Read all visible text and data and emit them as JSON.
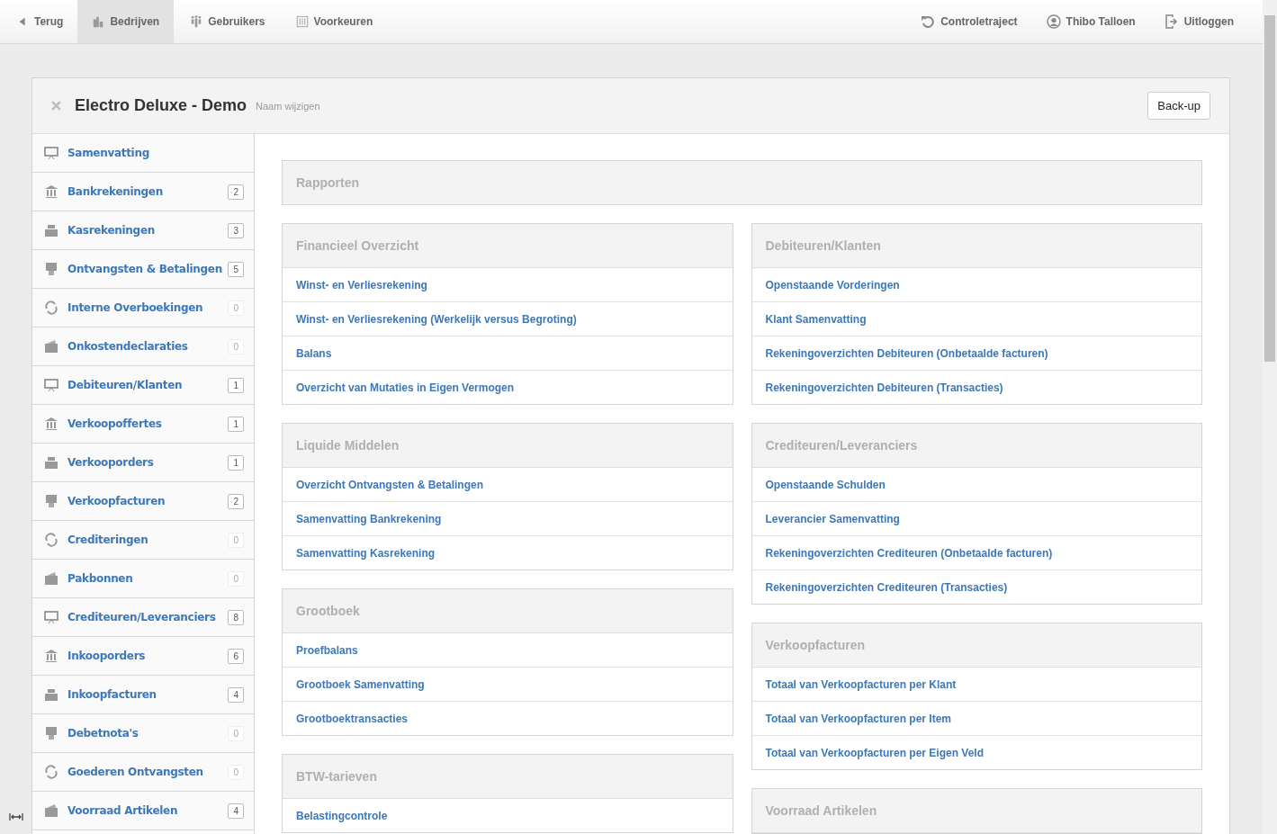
{
  "nav": {
    "left": [
      {
        "label": "Terug",
        "selected": false
      },
      {
        "label": "Bedrijven",
        "selected": true
      },
      {
        "label": "Gebruikers",
        "selected": false
      },
      {
        "label": "Voorkeuren",
        "selected": false
      }
    ],
    "right": [
      {
        "label": "Controletraject"
      },
      {
        "label": "Thibo Talloen"
      },
      {
        "label": "Uitloggen"
      }
    ]
  },
  "company": {
    "name": "Electro Deluxe - Demo",
    "rename_link": "Naam wijzigen",
    "backup_button": "Back-up"
  },
  "sidebar": {
    "items": [
      {
        "label": "Samenvatting"
      },
      {
        "label": "Bankrekeningen",
        "count": "2",
        "disabled": false
      },
      {
        "label": "Kasrekeningen",
        "count": "3",
        "disabled": false
      },
      {
        "label": "Ontvangsten & Betalingen",
        "count": "5",
        "disabled": false
      },
      {
        "label": "Interne Overboekingen",
        "count": "0",
        "disabled": true
      },
      {
        "label": "Onkostendeclaraties",
        "count": "0",
        "disabled": true
      },
      {
        "label": "Debiteuren/Klanten",
        "count": "1",
        "disabled": false
      },
      {
        "label": "Verkoopoffertes",
        "count": "1",
        "disabled": false
      },
      {
        "label": "Verkooporders",
        "count": "1",
        "disabled": false
      },
      {
        "label": "Verkoopfacturen",
        "count": "2",
        "disabled": false
      },
      {
        "label": "Crediteringen",
        "count": "0",
        "disabled": true
      },
      {
        "label": "Pakbonnen",
        "count": "0",
        "disabled": true
      },
      {
        "label": "Crediteuren/Leveranciers",
        "count": "8",
        "disabled": false
      },
      {
        "label": "Inkooporders",
        "count": "6",
        "disabled": false
      },
      {
        "label": "Inkoopfacturen",
        "count": "4",
        "disabled": false
      },
      {
        "label": "Debetnota's",
        "count": "0",
        "disabled": true
      },
      {
        "label": "Goederen Ontvangsten",
        "count": "0",
        "disabled": true
      },
      {
        "label": "Voorraad Artikelen",
        "count": "4",
        "disabled": false
      }
    ]
  },
  "reports": {
    "title": "Rapporten",
    "columns": [
      [
        {
          "title": "Financieel Overzicht",
          "links": [
            "Winst- en Verliesrekening",
            "Winst- en Verliesrekening (Werkelijk versus Begroting)",
            "Balans",
            "Overzicht van Mutaties in Eigen Vermogen"
          ]
        },
        {
          "title": "Liquide Middelen",
          "links": [
            "Overzicht Ontvangsten & Betalingen",
            "Samenvatting Bankrekening",
            "Samenvatting Kasrekening"
          ]
        },
        {
          "title": "Grootboek",
          "links": [
            "Proefbalans",
            "Grootboek Samenvatting",
            "Grootboektransacties"
          ]
        },
        {
          "title": "BTW-tarieven",
          "links": [
            "Belastingcontrole"
          ]
        }
      ],
      [
        {
          "title": "Debiteuren/Klanten",
          "links": [
            "Openstaande Vorderingen",
            "Klant Samenvatting",
            "Rekeningoverzichten Debiteuren (Onbetaalde facturen)",
            "Rekeningoverzichten Debiteuren (Transacties)"
          ]
        },
        {
          "title": "Crediteuren/Leveranciers",
          "links": [
            "Openstaande Schulden",
            "Leverancier Samenvatting",
            "Rekeningoverzichten Crediteuren (Onbetaalde facturen)",
            "Rekeningoverzichten Crediteuren (Transacties)"
          ]
        },
        {
          "title": "Verkoopfacturen",
          "links": [
            "Totaal van Verkoopfacturen per Klant",
            "Totaal van Verkoopfacturen per Item",
            "Totaal van Verkoopfacturen per Eigen Veld"
          ]
        },
        {
          "title": "Voorraad Artikelen"
        }
      ]
    ]
  }
}
